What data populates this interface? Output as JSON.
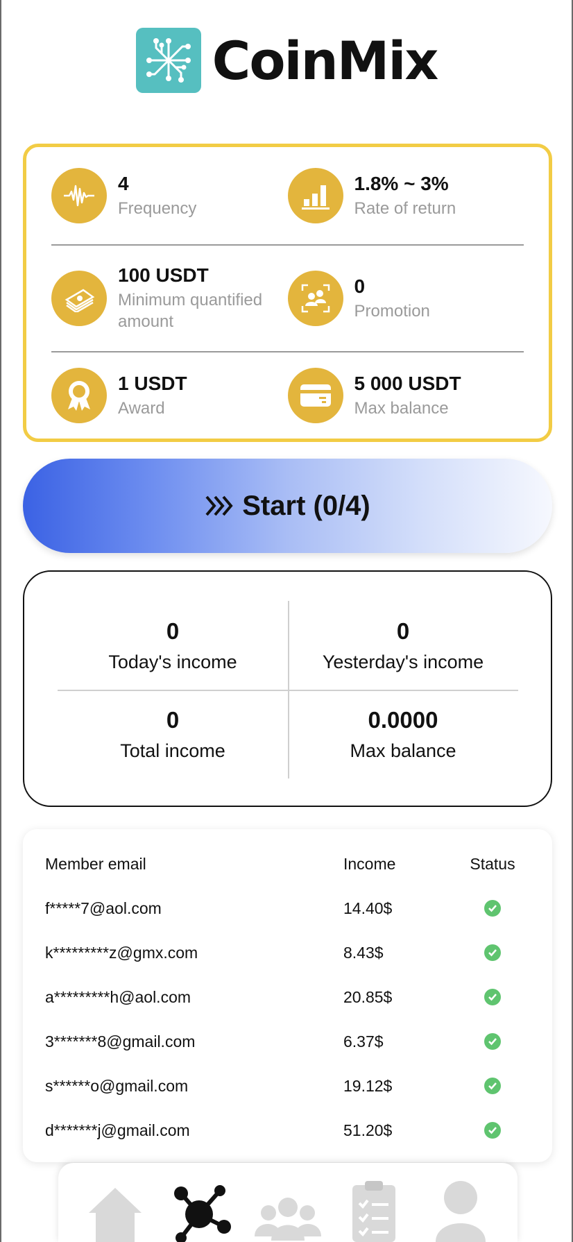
{
  "app": {
    "name": "CoinMix",
    "logo_icon": "circuit-logo-icon",
    "brand_color": "#56bfc0"
  },
  "stats": {
    "accent": "#e3b53d",
    "frame_color": "#f2cc45",
    "items": [
      {
        "value": "4",
        "label": "Frequency",
        "icon": "waveform-icon"
      },
      {
        "value": "1.8% ~ 3%",
        "label": "Rate of return",
        "icon": "bar-chart-icon"
      },
      {
        "value": "100 USDT",
        "label": "Minimum quantified amount",
        "icon": "cash-stack-icon"
      },
      {
        "value": "0",
        "label": "Promotion",
        "icon": "users-frame-icon"
      },
      {
        "value": "1 USDT",
        "label": "Award",
        "icon": "award-ribbon-icon"
      },
      {
        "value": "5 000 USDT",
        "label": "Max balance",
        "icon": "card-icon"
      }
    ]
  },
  "start_button": {
    "label": "Start (0/4)",
    "icon": "double-chevron-right-icon"
  },
  "income": {
    "today": {
      "value": "0",
      "label": "Today's income"
    },
    "yesterday": {
      "value": "0",
      "label": "Yesterday's income"
    },
    "total": {
      "value": "0",
      "label": "Total income"
    },
    "max_balance": {
      "value": "0.0000",
      "label": "Max balance"
    }
  },
  "members": {
    "headers": {
      "email": "Member email",
      "income": "Income",
      "status": "Status"
    },
    "status_color": "#5fc46f",
    "rows": [
      {
        "email": "f*****7@aol.com",
        "income": "14.40$",
        "status": "check-circle-icon"
      },
      {
        "email": "k*********z@gmx.com",
        "income": "8.43$",
        "status": "check-circle-icon"
      },
      {
        "email": "a*********h@aol.com",
        "income": "20.85$",
        "status": "check-circle-icon"
      },
      {
        "email": "3*******8@gmail.com",
        "income": "6.37$",
        "status": "check-circle-icon"
      },
      {
        "email": "s******o@gmail.com",
        "income": "19.12$",
        "status": "check-circle-icon"
      },
      {
        "email": "d*******j@gmail.com",
        "income": "51.20$",
        "status": "check-circle-icon"
      }
    ]
  },
  "bottom_nav": {
    "items": [
      {
        "icon": "home-icon",
        "active": false
      },
      {
        "icon": "network-nodes-icon",
        "active": true
      },
      {
        "icon": "team-icon",
        "active": false
      },
      {
        "icon": "clipboard-list-icon",
        "active": false
      },
      {
        "icon": "user-icon",
        "active": false
      }
    ]
  }
}
